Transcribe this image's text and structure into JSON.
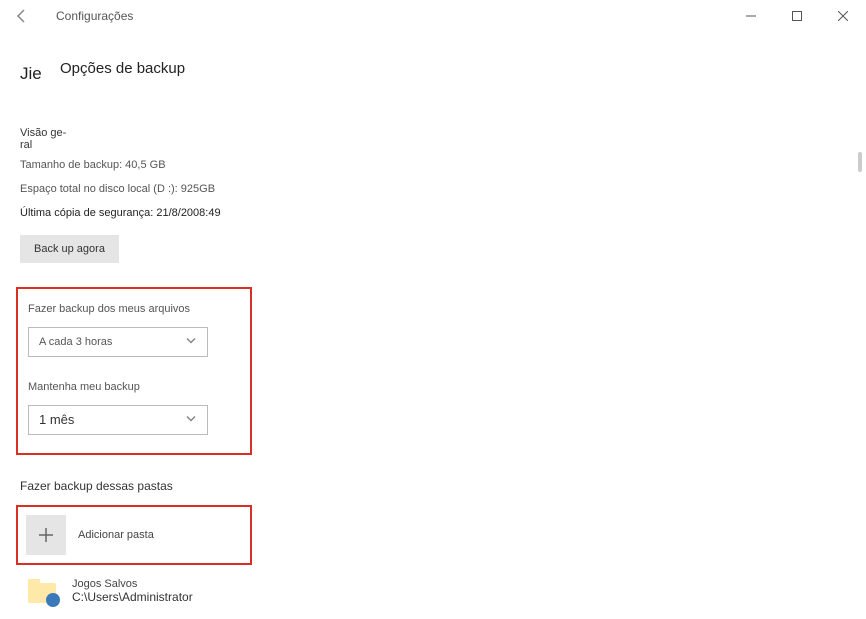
{
  "window": {
    "title": "Configurações"
  },
  "user_label": "Jie",
  "page_title": "Opções de backup",
  "overview": {
    "heading": "Visão ge-ral",
    "backup_size": "Tamanho de backup: 40,5 GB",
    "disk_space": "Espaço total no disco local (D :): 925GB",
    "last_backup": "Última cópia de segurança: 21/8/2008:49"
  },
  "backup_button": "Back up agora",
  "frequency": {
    "label": "Fazer backup dos meus arquivos",
    "value": "A cada 3 horas"
  },
  "retention": {
    "label": "Mantenha meu backup",
    "value": "1 mês"
  },
  "folders_section": {
    "heading": "Fazer backup dessas pastas",
    "add_label": "Adicionar pasta"
  },
  "folder_item": {
    "name": "Jogos Salvos",
    "path": "C:\\Users\\Administrator"
  }
}
